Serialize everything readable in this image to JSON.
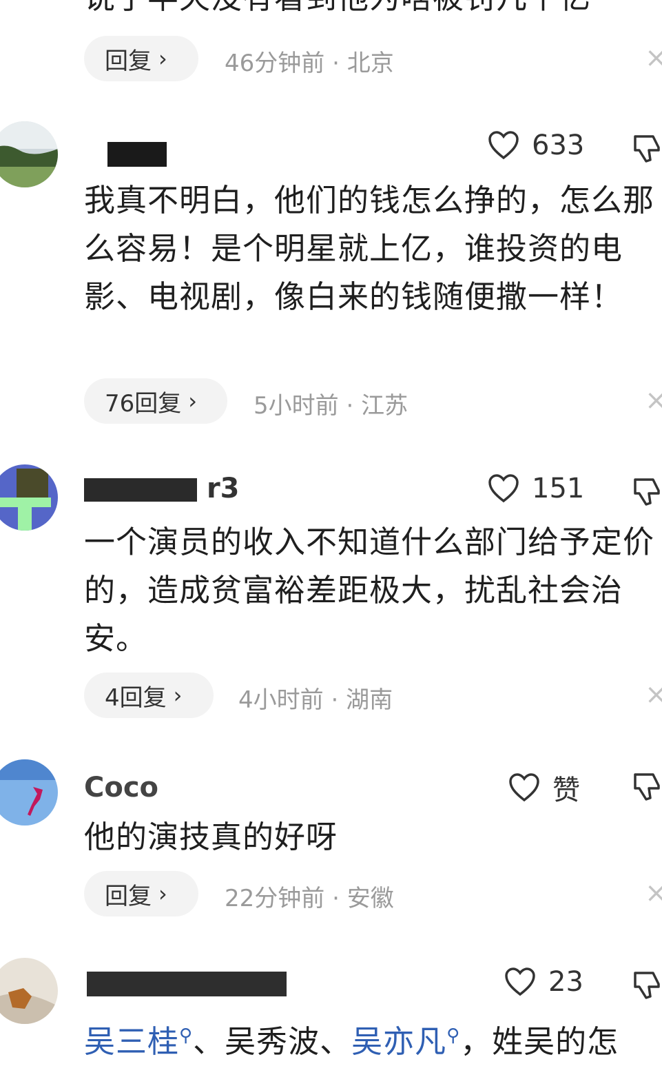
{
  "comments": [
    {
      "text_partial": "说了半天没有看到他为啥被罚几个亿",
      "reply_label": "回复",
      "time": "46分钟前",
      "location": "北京"
    },
    {
      "username_visible": "",
      "likes": "633",
      "text": "我真不明白，他们的钱怎么挣的，怎么那么容易！是个明星就上亿，谁投资的电影、电视剧，像白来的钱随便撒一样！",
      "reply_label": "76回复",
      "time": "5小时前",
      "location": "江苏"
    },
    {
      "username_visible": "r3",
      "likes": "151",
      "text": "一个演员的收入不知道什么部门给予定价的，造成贫富裕差距极大，扰乱社会治安。",
      "reply_label": "4回复",
      "time": "4小时前",
      "location": "湖南"
    },
    {
      "username_visible": "Coco",
      "likes": "赞",
      "text": "他的演技真的好呀",
      "reply_label": "回复",
      "time": "22分钟前",
      "location": "安徽"
    },
    {
      "username_visible": "",
      "likes": "23",
      "mention1": "吴三桂",
      "sep1": "、吴秀波、",
      "mention2": "吴亦凡",
      "tail": "，姓吴的怎"
    }
  ],
  "separator": "·",
  "chevron": "›",
  "close_glyph": "×",
  "colors": {
    "mention": "#2f5fb3",
    "meta": "#9a9a9a",
    "pill": "#f3f3f3"
  }
}
